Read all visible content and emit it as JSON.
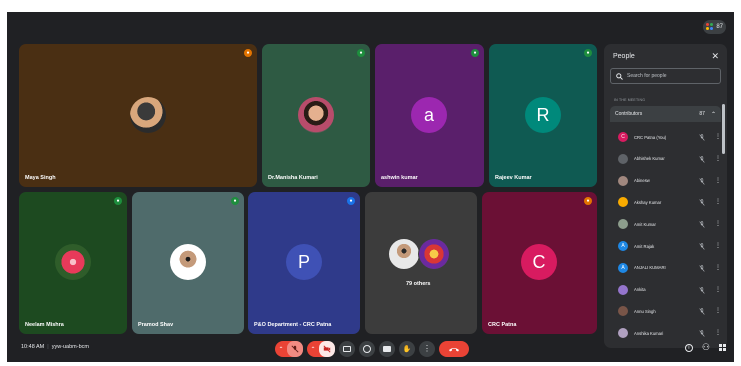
{
  "badge": {
    "count": "87"
  },
  "tiles": {
    "maya": {
      "name": "Maya Singh"
    },
    "manisha": {
      "name": "Dr.Manisha Kumari"
    },
    "ashwin": {
      "name": "ashwin kumar",
      "initial": "a"
    },
    "rajeev": {
      "name": "Rajeev Kumar",
      "initial": "R"
    },
    "neelam": {
      "name": "Neelam Mishra"
    },
    "pramod": {
      "name": "Pramod Shav"
    },
    "pando": {
      "name": "P&O Department - CRC Patna",
      "initial": "P"
    },
    "others": {
      "label": "79 others"
    },
    "crc": {
      "name": "CRC Patna",
      "initial": "C"
    }
  },
  "people_panel": {
    "title": "People",
    "close": "✕",
    "search_placeholder": "Search for people",
    "section_label": "IN THE MEETING",
    "group_label": "Contributors",
    "group_count": "87",
    "participants": [
      {
        "name": "CRC Patna (You)",
        "initial": "C",
        "color": "#d81b60"
      },
      {
        "name": "Abhishek Kumar",
        "initial": "",
        "color": "#5f6368"
      },
      {
        "name": "Abinesw",
        "initial": "",
        "color": "#a1887f"
      },
      {
        "name": "Akshay Kumar",
        "initial": "",
        "color": "#f9ab00"
      },
      {
        "name": "Amit Kumar",
        "initial": "",
        "color": "#8d9e8d"
      },
      {
        "name": "Amit Rajak",
        "initial": "A",
        "color": "#1e88e5"
      },
      {
        "name": "ANJALI KUMARI",
        "initial": "A",
        "color": "#1e88e5"
      },
      {
        "name": "Ankita",
        "initial": "",
        "color": "#9575cd"
      },
      {
        "name": "Annu Singh",
        "initial": "",
        "color": "#795548"
      },
      {
        "name": "Anshika Kumari",
        "initial": "",
        "color": "#b0a0c0"
      }
    ]
  },
  "bottom": {
    "time": "10:48 AM",
    "code": "yyw-uabm-bcm"
  },
  "colors": {
    "background": "#202124",
    "mic_green": "#1e8e3e",
    "mic_orange": "#e37400",
    "hangup": "#ea4335"
  }
}
